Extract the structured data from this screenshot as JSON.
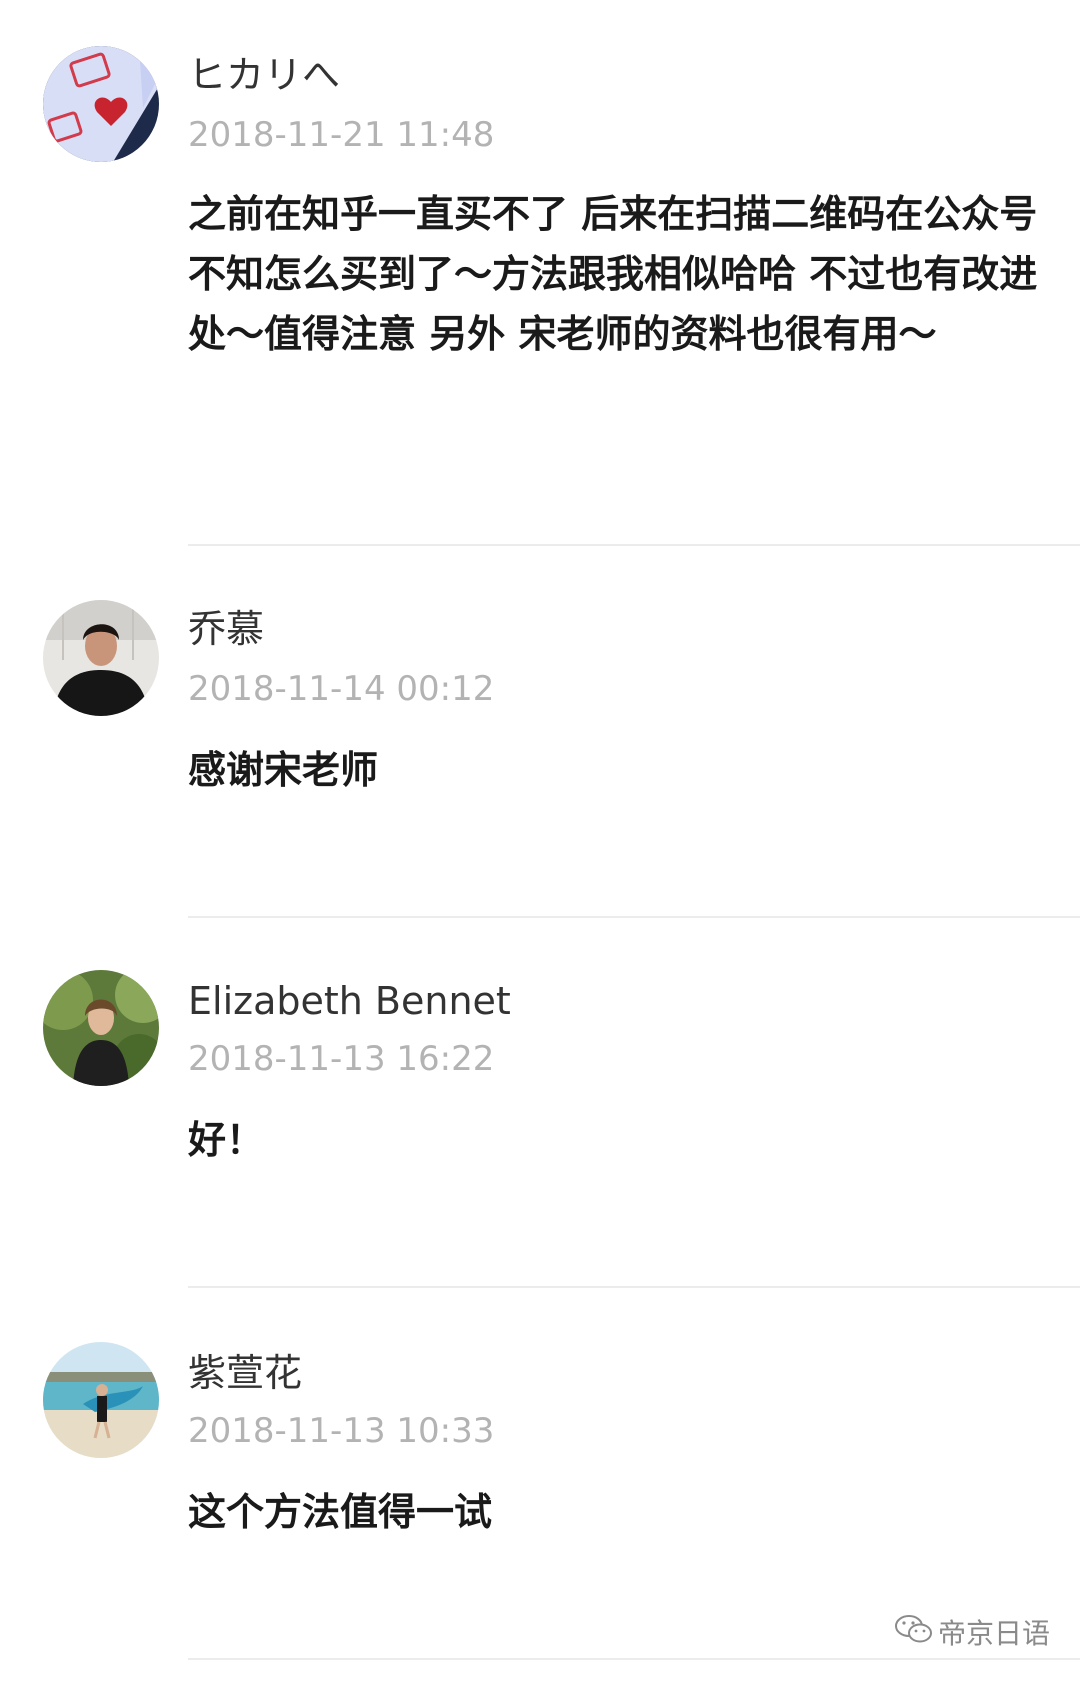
{
  "comments": [
    {
      "name": "ヒカリへ",
      "time": "2018-11-21 11:48",
      "text": "之前在知乎一直买不了 后来在扫描二维码在公众号不知怎么买到了～方法跟我相似哈哈 不过也有改进处～值得注意 另外 宋老师的资料也很有用～",
      "avatar_icon": "heart-card-avatar"
    },
    {
      "name": "乔慕",
      "time": "2018-11-14 00:12",
      "text": "感谢宋老师",
      "avatar_icon": "person-black-hoodie-avatar"
    },
    {
      "name": "Elizabeth Bennet",
      "time": "2018-11-13 16:22",
      "text": "好！",
      "avatar_icon": "woman-in-garden-avatar"
    },
    {
      "name": "紫萱花",
      "time": "2018-11-13 10:33",
      "text": "这个方法值得一试",
      "avatar_icon": "girl-on-beach-avatar"
    }
  ],
  "watermark": {
    "icon": "wechat-icon",
    "label": "帝京日语"
  },
  "colors": {
    "name": "#333333",
    "time": "#b3b3b3",
    "text": "#1a1a1a",
    "divider": "#ececec"
  }
}
